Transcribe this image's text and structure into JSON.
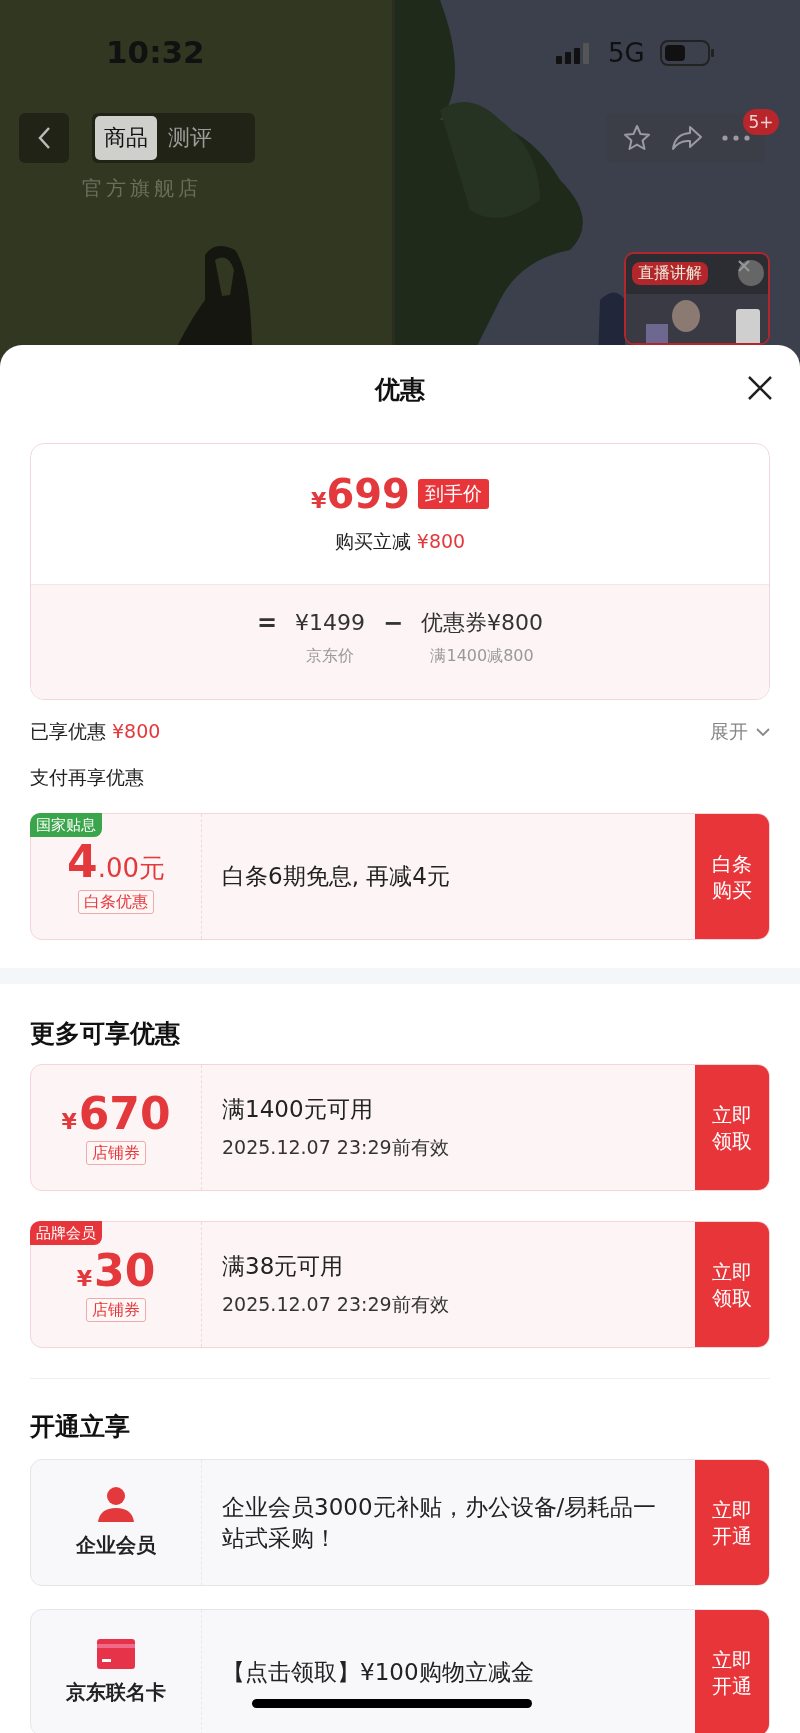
{
  "status_bar": {
    "time": "10:32",
    "network": "5G"
  },
  "nav": {
    "tabs": [
      {
        "label": "商品",
        "selected": true
      },
      {
        "label": "测评",
        "selected": false
      }
    ],
    "store_label": "官方旗舰店",
    "badge": "5+"
  },
  "live_popup": {
    "tag": "直播讲解"
  },
  "sheet": {
    "title": "优惠",
    "price_card": {
      "currency": "¥",
      "price": "699",
      "price_tag": "到手价",
      "instant_label": "购买立减",
      "instant_amount": "¥800",
      "formula": [
        {
          "kind": "operator",
          "text": "="
        },
        {
          "kind": "term",
          "value": "¥1499",
          "caption": "京东价"
        },
        {
          "kind": "operator",
          "text": "−"
        },
        {
          "kind": "term",
          "value": "优惠券¥800",
          "caption": "满1400减800"
        }
      ]
    },
    "enjoyed": {
      "label": "已享优惠",
      "amount": "¥800",
      "toggle": "展开",
      "expanded": false
    },
    "pay_title": "支付再享优惠",
    "pay_offers": [
      {
        "kind": "rate",
        "tag": {
          "text": "国家贴息",
          "color": "#3aa54a"
        },
        "amount": "4",
        "amount_suffix": ".00元",
        "label": "白条优惠",
        "text": "白条6期免息, 再减4元",
        "button": [
          "白条",
          "购买"
        ]
      }
    ],
    "more_title": "更多可享优惠",
    "coupons": [
      {
        "kind": "coupon",
        "currency": "¥",
        "amount": "670",
        "label": "店铺券",
        "condition": "满1400元可用",
        "validity": "2025.12.07 23:29前有效",
        "button": [
          "立即",
          "领取"
        ]
      },
      {
        "kind": "coupon",
        "tag": {
          "text": "品牌会员",
          "color": "#e6363b"
        },
        "currency": "¥",
        "amount": "30",
        "label": "店铺券",
        "condition": "满38元可用",
        "validity": "2025.12.07 23:29前有效",
        "button": [
          "立即",
          "领取"
        ]
      }
    ],
    "open_title": "开通立享",
    "services": [
      {
        "kind": "member",
        "name": "企业会员",
        "text": "企业会员3000元补贴，办公设备/易耗品一站式采购！",
        "button": [
          "立即",
          "开通"
        ]
      },
      {
        "kind": "card",
        "name": "京东联名卡",
        "text": "【点击领取】¥100购物立减金",
        "button": [
          "立即",
          "开通"
        ]
      }
    ]
  }
}
